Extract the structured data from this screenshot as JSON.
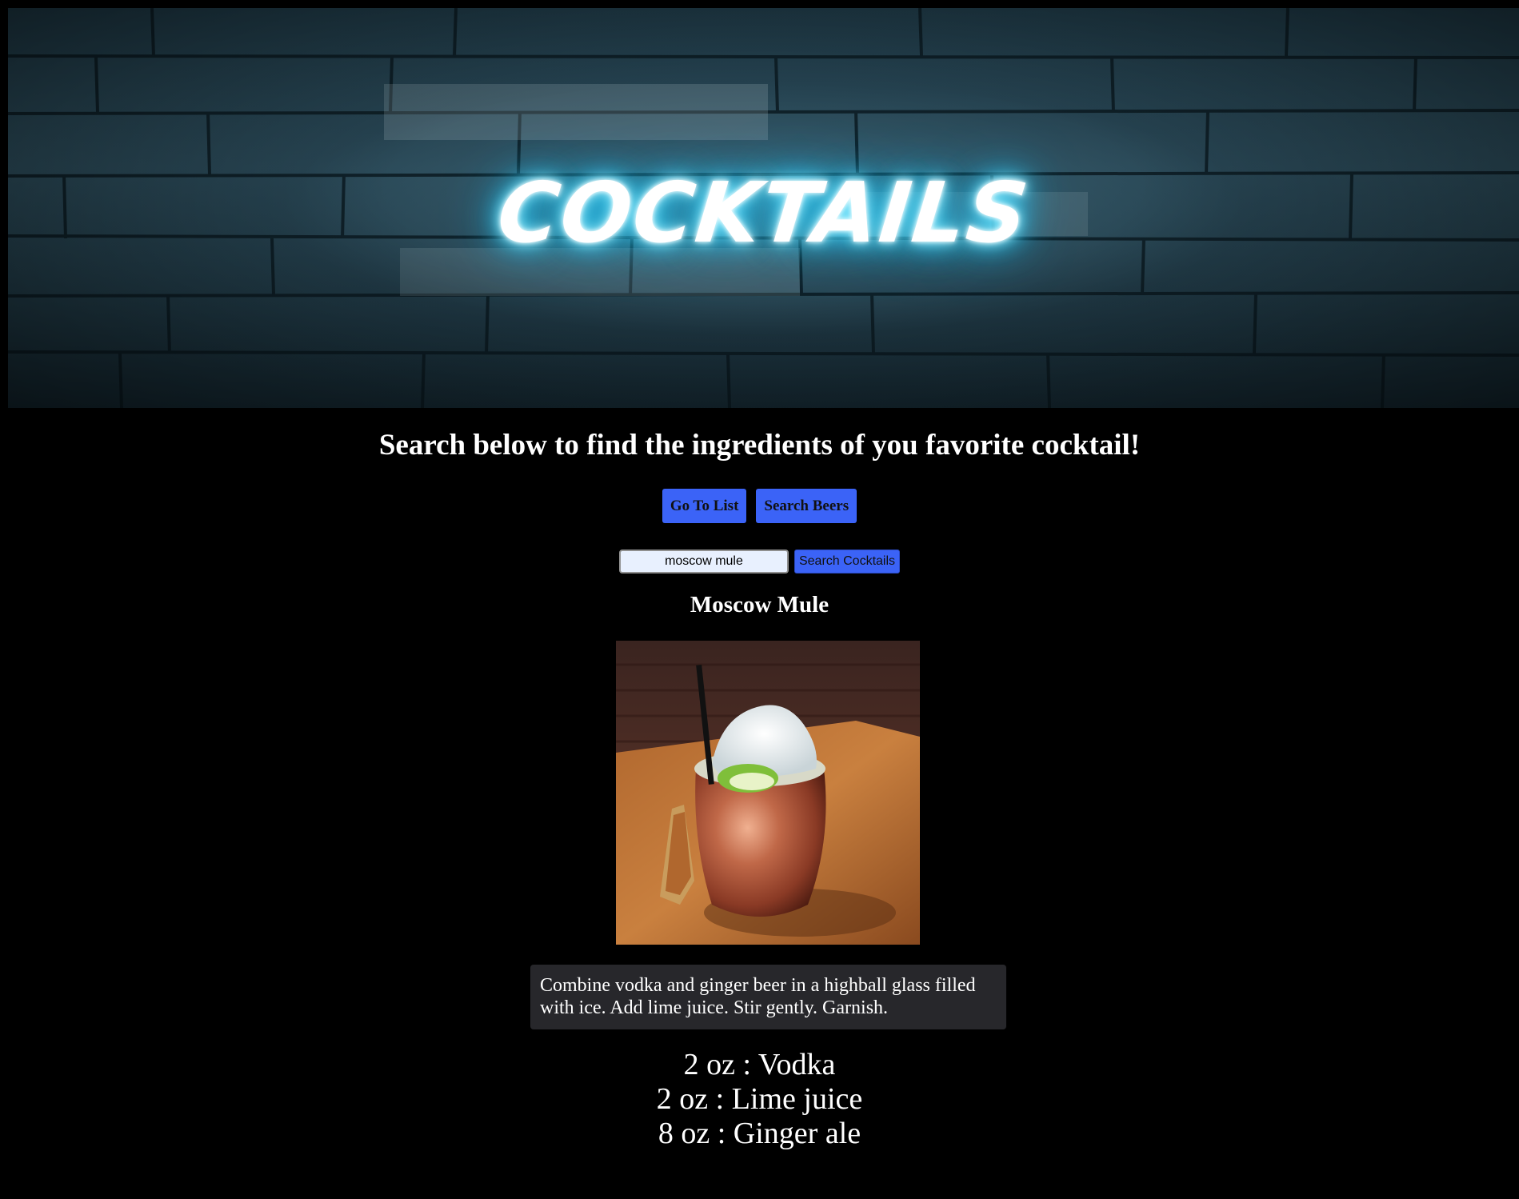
{
  "banner": {
    "title": "COCKTAILS"
  },
  "headline": "Search below to find the ingredients of you favorite cocktail!",
  "nav": {
    "go_to_list": "Go To List",
    "search_beers": "Search Beers"
  },
  "search": {
    "value": "moscow mule",
    "button_label": "Search Cocktails"
  },
  "drink": {
    "name": "Moscow Mule",
    "instructions": "Combine vodka and ginger beer in a highball glass filled with ice. Add lime juice. Stir gently. Garnish.",
    "ingredients": [
      "2 oz : Vodka",
      "2 oz : Lime juice",
      "8 oz : Ginger ale"
    ]
  },
  "colors": {
    "background": "#000000",
    "button": "#3b63f7",
    "instructions_bg": "#27272b",
    "neon_glow": "#4fe0ff"
  }
}
